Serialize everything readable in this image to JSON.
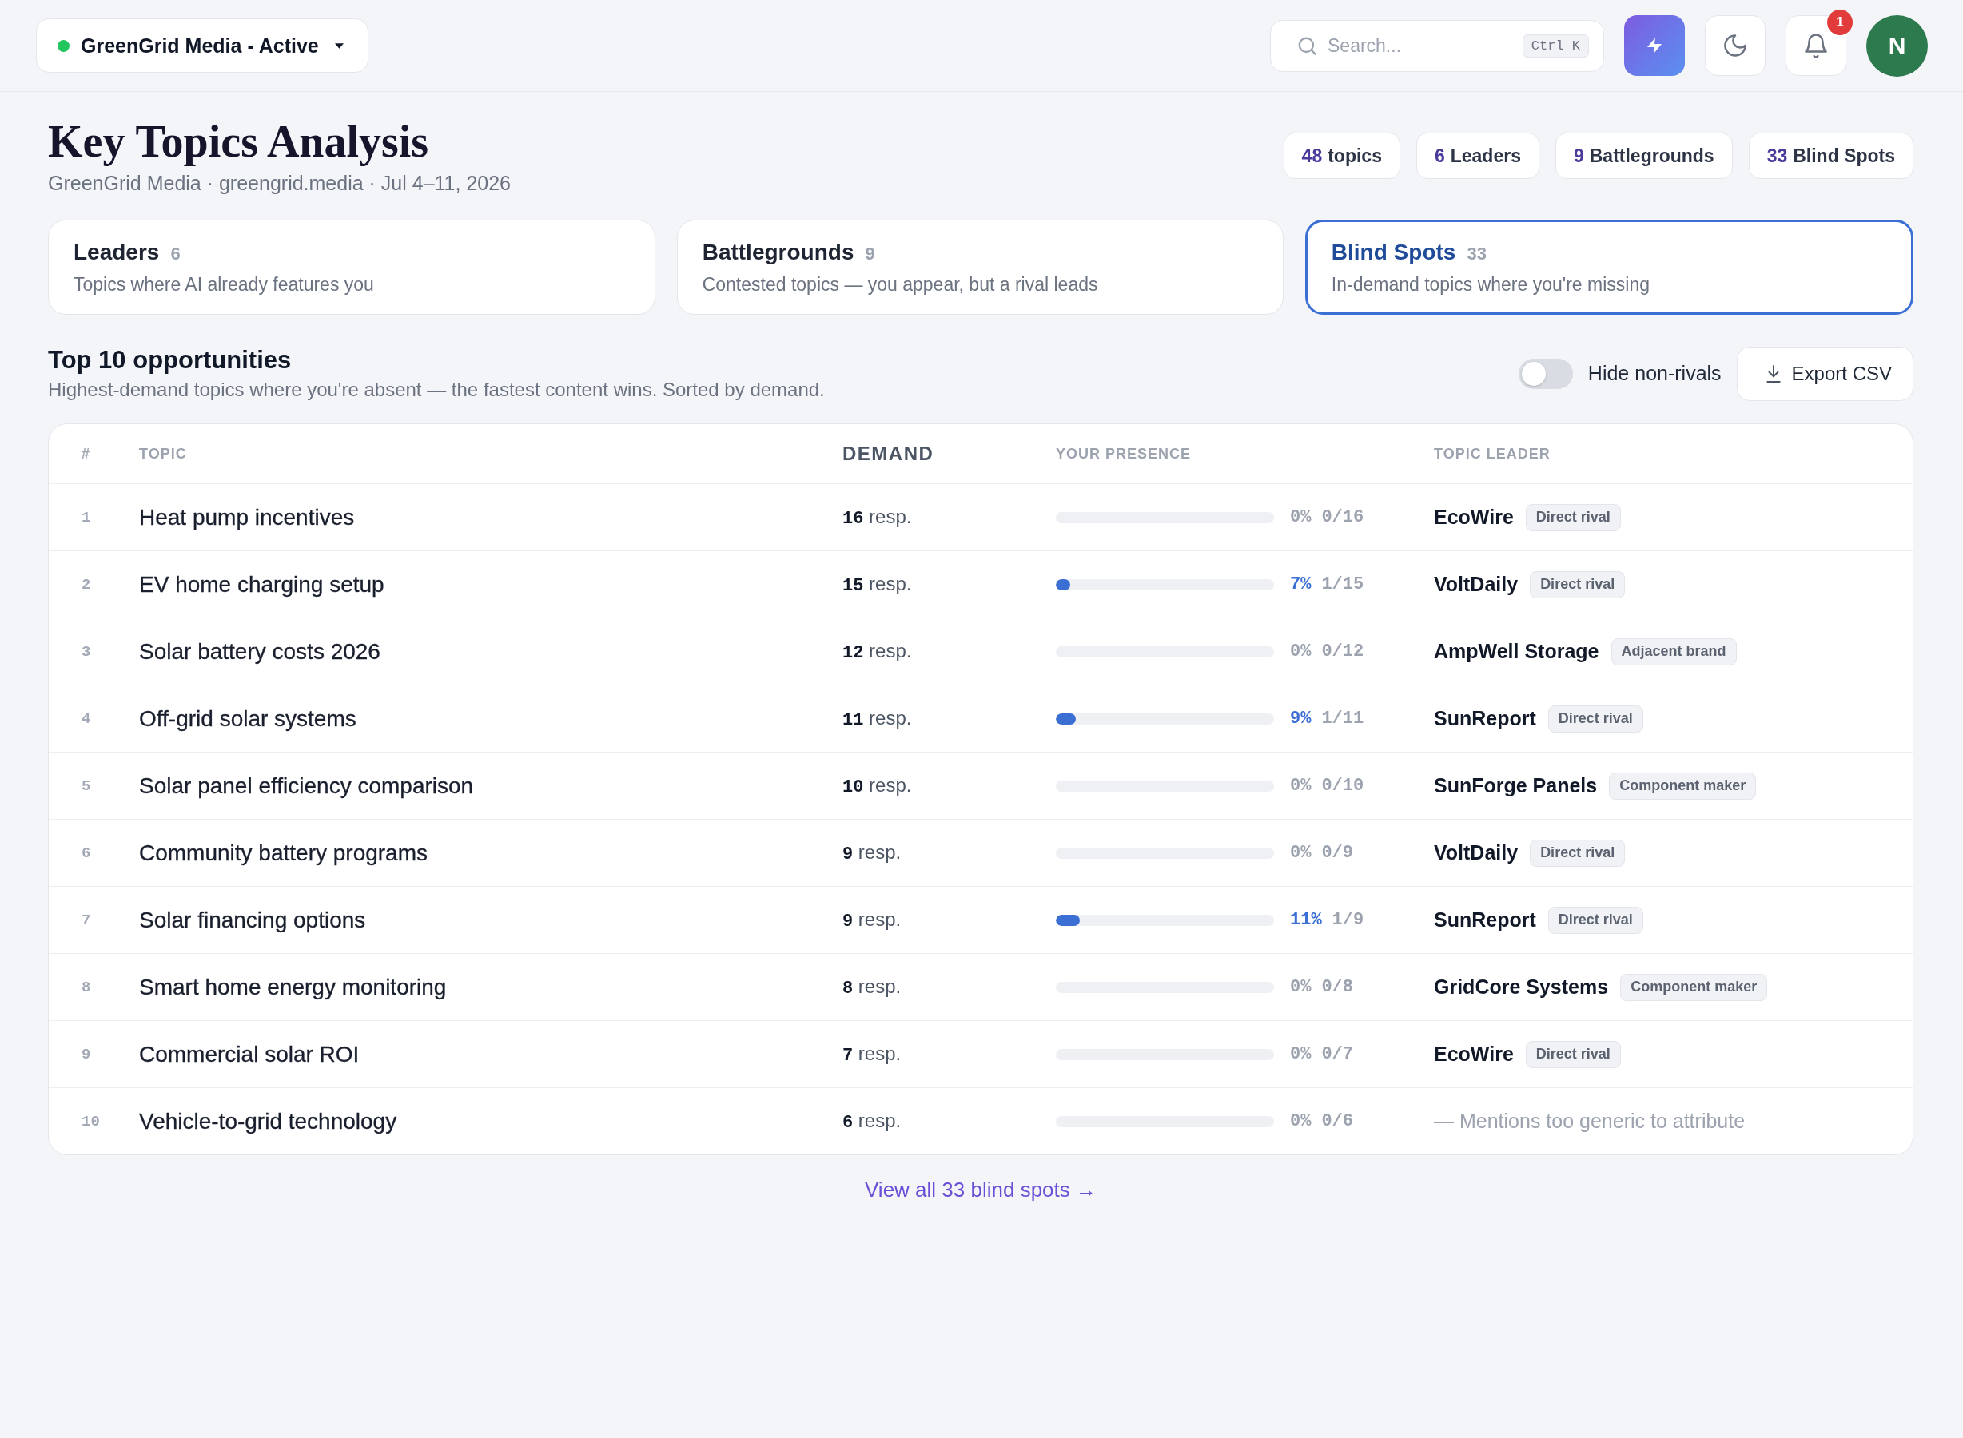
{
  "top_bar": {
    "workspace": {
      "label": "GreenGrid Media - Active",
      "active": true
    },
    "search": {
      "placeholder": "Search...",
      "shortcut": "Ctrl K"
    },
    "notifications": {
      "count": "1"
    },
    "avatar": {
      "initial": "N"
    }
  },
  "header": {
    "title": "Key Topics Analysis",
    "subtitle": "GreenGrid Media · greengrid.media · Jul 4–11, 2026",
    "stats": [
      {
        "value": "48",
        "label": "topics"
      },
      {
        "value": "6",
        "label": "Leaders"
      },
      {
        "value": "9",
        "label": "Battlegrounds"
      },
      {
        "value": "33",
        "label": "Blind Spots"
      }
    ]
  },
  "segments": [
    {
      "title": "Leaders",
      "count": "6",
      "description": "Topics where AI already features you",
      "selected": false
    },
    {
      "title": "Battlegrounds",
      "count": "9",
      "description": "Contested topics — you appear, but a rival leads",
      "selected": false
    },
    {
      "title": "Blind Spots",
      "count": "33",
      "description": "In-demand topics where you're missing",
      "selected": true
    }
  ],
  "opportunities": {
    "title": "Top 10 opportunities",
    "subtitle": "Highest-demand topics where you're absent — the fastest content wins. Sorted by demand.",
    "hide_non_rivals": {
      "label": "Hide non-rivals",
      "on": false
    },
    "export_button": "Export CSV",
    "table": {
      "columns": [
        {
          "label": "#",
          "sorted": false
        },
        {
          "label": "TOPIC",
          "sorted": false
        },
        {
          "label": "DEMAND",
          "sorted": true
        },
        {
          "label": "YOUR PRESENCE",
          "sorted": false
        },
        {
          "label": "TOPIC LEADER",
          "sorted": false
        }
      ],
      "rows": [
        {
          "rank": "1",
          "topic": "Heat pump incentives",
          "demand": "**16** resp.",
          "presence": {
            "level": 0,
            "percent": "0%",
            "count": "0/16"
          },
          "leader": {
            "kind": "brand",
            "name": "EcoWire",
            "tag": "Direct rival"
          }
        },
        {
          "rank": "2",
          "topic": "EV home charging setup",
          "demand": "**15** resp.",
          "presence": {
            "level": 0.067,
            "percent": "7%",
            "count": "1/15"
          },
          "leader": {
            "kind": "brand",
            "name": "VoltDaily",
            "tag": "Direct rival"
          }
        },
        {
          "rank": "3",
          "topic": "Solar battery costs 2026",
          "demand": "**12** resp.",
          "presence": {
            "level": 0,
            "percent": "0%",
            "count": "0/12"
          },
          "leader": {
            "kind": "brand",
            "name": "AmpWell Storage",
            "tag": "Adjacent brand"
          }
        },
        {
          "rank": "4",
          "topic": "Off-grid solar systems",
          "demand": "**11** resp.",
          "presence": {
            "level": 0.091,
            "percent": "9%",
            "count": "1/11"
          },
          "leader": {
            "kind": "brand",
            "name": "SunReport",
            "tag": "Direct rival"
          }
        },
        {
          "rank": "5",
          "topic": "Solar panel efficiency comparison",
          "demand": "**10** resp.",
          "presence": {
            "level": 0,
            "percent": "0%",
            "count": "0/10"
          },
          "leader": {
            "kind": "brand",
            "name": "SunForge Panels",
            "tag": "Component maker"
          }
        },
        {
          "rank": "6",
          "topic": "Community battery programs",
          "demand": "**9** resp.",
          "presence": {
            "level": 0,
            "percent": "0%",
            "count": "0/9"
          },
          "leader": {
            "kind": "brand",
            "name": "VoltDaily",
            "tag": "Direct rival"
          }
        },
        {
          "rank": "7",
          "topic": "Solar financing options",
          "demand": "**9** resp.",
          "presence": {
            "level": 0.111,
            "percent": "11%",
            "count": "1/9"
          },
          "leader": {
            "kind": "brand",
            "name": "SunReport",
            "tag": "Direct rival"
          }
        },
        {
          "rank": "8",
          "topic": "Smart home energy monitoring",
          "demand": "**8** resp.",
          "presence": {
            "level": 0,
            "percent": "0%",
            "count": "0/8"
          },
          "leader": {
            "kind": "brand",
            "name": "GridCore Systems",
            "tag": "Component maker"
          }
        },
        {
          "rank": "9",
          "topic": "Commercial solar ROI",
          "demand": "**7** resp.",
          "presence": {
            "level": 0,
            "percent": "0%",
            "count": "0/7"
          },
          "leader": {
            "kind": "brand",
            "name": "EcoWire",
            "tag": "Direct rival"
          }
        },
        {
          "rank": "10",
          "topic": "Vehicle-to-grid technology",
          "demand": "**6** resp.",
          "presence": {
            "level": 0,
            "percent": "0%",
            "count": "0/6"
          },
          "leader": {
            "kind": "none",
            "text": "— Mentions too generic to attribute"
          }
        }
      ]
    },
    "view_all_link": "View all 33 blind spots →"
  }
}
